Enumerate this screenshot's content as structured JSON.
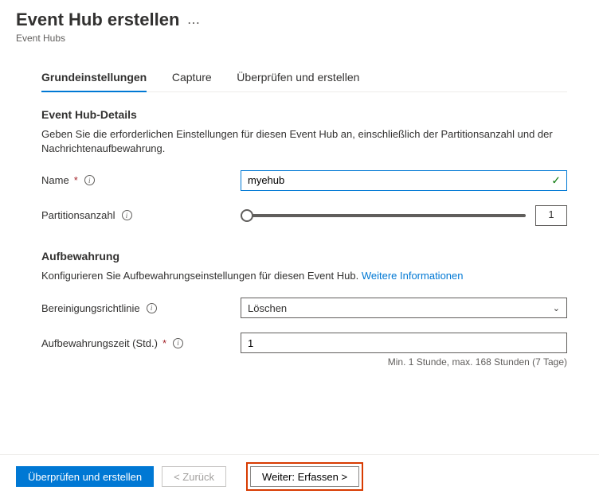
{
  "header": {
    "title": "Event Hub erstellen",
    "breadcrumb": "Event Hubs"
  },
  "tabs": [
    {
      "label": "Grundeinstellungen",
      "active": true
    },
    {
      "label": "Capture",
      "active": false
    },
    {
      "label": "Überprüfen und erstellen",
      "active": false
    }
  ],
  "details": {
    "section_title": "Event Hub-Details",
    "section_desc": "Geben Sie die erforderlichen Einstellungen für diesen Event Hub an, einschließlich der Partitionsanzahl und der Nachrichtenaufbewahrung.",
    "name_label": "Name",
    "name_value": "myehub",
    "partitions_label": "Partitionsanzahl",
    "partitions_value": "1"
  },
  "retention": {
    "section_title": "Aufbewahrung",
    "section_desc_prefix": "Konfigurieren Sie Aufbewahrungseinstellungen für diesen Event Hub. ",
    "more_info": "Weitere Informationen",
    "cleanup_label": "Bereinigungsrichtlinie",
    "cleanup_value": "Löschen",
    "time_label": "Aufbewahrungszeit (Std.)",
    "time_value": "1",
    "hint": "Min. 1 Stunde, max. 168 Stunden (7 Tage)"
  },
  "footer": {
    "review": "Überprüfen und erstellen",
    "back": "<  Zurück",
    "next": "Weiter: Erfassen  >"
  }
}
